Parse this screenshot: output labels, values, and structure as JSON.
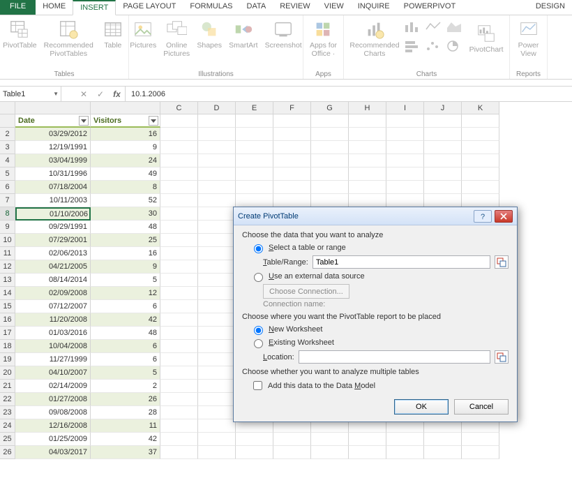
{
  "tabs": {
    "file": "FILE",
    "home": "HOME",
    "insert": "INSERT",
    "pagelayout": "PAGE LAYOUT",
    "formulas": "FORMULAS",
    "data": "DATA",
    "review": "REVIEW",
    "view": "VIEW",
    "inquire": "INQUIRE",
    "powerpivot": "POWERPIVOT",
    "design": "DESIGN"
  },
  "ribbon": {
    "tables": {
      "pivottable": "PivotTable",
      "recpivot": "Recommended\nPivotTables",
      "table": "Table",
      "label": "Tables"
    },
    "ill": {
      "pictures": "Pictures",
      "online": "Online\nPictures",
      "shapes": "Shapes",
      "smartart": "SmartArt",
      "screenshot": "Screenshot",
      "label": "Illustrations"
    },
    "apps": {
      "apps": "Apps for\nOffice ·",
      "label": "Apps"
    },
    "charts": {
      "rec": "Recommended\nCharts",
      "pivotchart": "PivotChart",
      "label": "Charts"
    },
    "reports": {
      "powerview": "Power\nView",
      "label": "Reports"
    }
  },
  "fbar": {
    "name": "Table1",
    "value": "10.1.2006"
  },
  "columns": [
    "",
    "",
    "C",
    "D",
    "E",
    "F",
    "G",
    "H",
    "I",
    "J",
    "K"
  ],
  "headers": {
    "date": "Date",
    "visitors": "Visitors"
  },
  "rows": [
    {
      "n": 2,
      "d": "03/29/2012",
      "v": 16
    },
    {
      "n": 3,
      "d": "12/19/1991",
      "v": 9
    },
    {
      "n": 4,
      "d": "03/04/1999",
      "v": 24
    },
    {
      "n": 5,
      "d": "10/31/1996",
      "v": 49
    },
    {
      "n": 6,
      "d": "07/18/2004",
      "v": 8
    },
    {
      "n": 7,
      "d": "10/11/2003",
      "v": 52
    },
    {
      "n": 8,
      "d": "01/10/2006",
      "v": 30,
      "sel": true
    },
    {
      "n": 9,
      "d": "09/29/1991",
      "v": 48
    },
    {
      "n": 10,
      "d": "07/29/2001",
      "v": 25
    },
    {
      "n": 11,
      "d": "02/06/2013",
      "v": 16
    },
    {
      "n": 12,
      "d": "04/21/2005",
      "v": 9
    },
    {
      "n": 13,
      "d": "08/14/2014",
      "v": 5
    },
    {
      "n": 14,
      "d": "02/09/2008",
      "v": 12
    },
    {
      "n": 15,
      "d": "07/12/2007",
      "v": 6
    },
    {
      "n": 16,
      "d": "11/20/2008",
      "v": 42
    },
    {
      "n": 17,
      "d": "01/03/2016",
      "v": 48
    },
    {
      "n": 18,
      "d": "10/04/2008",
      "v": 6
    },
    {
      "n": 19,
      "d": "11/27/1999",
      "v": 6
    },
    {
      "n": 20,
      "d": "04/10/2007",
      "v": 5
    },
    {
      "n": 21,
      "d": "02/14/2009",
      "v": 2
    },
    {
      "n": 22,
      "d": "01/27/2008",
      "v": 26
    },
    {
      "n": 23,
      "d": "09/08/2008",
      "v": 28
    },
    {
      "n": 24,
      "d": "12/16/2008",
      "v": 11
    },
    {
      "n": 25,
      "d": "01/25/2009",
      "v": 42
    },
    {
      "n": 26,
      "d": "04/03/2017",
      "v": 37
    }
  ],
  "dialog": {
    "title": "Create PivotTable",
    "sec1": "Choose the data that you want to analyze",
    "opt_select": "Select a table or range",
    "tablerange_lbl": "Table/Range:",
    "tablerange_val": "Table1",
    "opt_ext": "Use an external data source",
    "choose_conn": "Choose Connection...",
    "conn_name": "Connection name:",
    "sec2": "Choose where you want the PivotTable report to be placed",
    "opt_new": "New Worksheet",
    "opt_exist": "Existing Worksheet",
    "loc_lbl": "Location:",
    "loc_val": "",
    "sec3": "Choose whether you want to analyze multiple tables",
    "chk_model": "Add this data to the Data Model",
    "ok": "OK",
    "cancel": "Cancel"
  }
}
